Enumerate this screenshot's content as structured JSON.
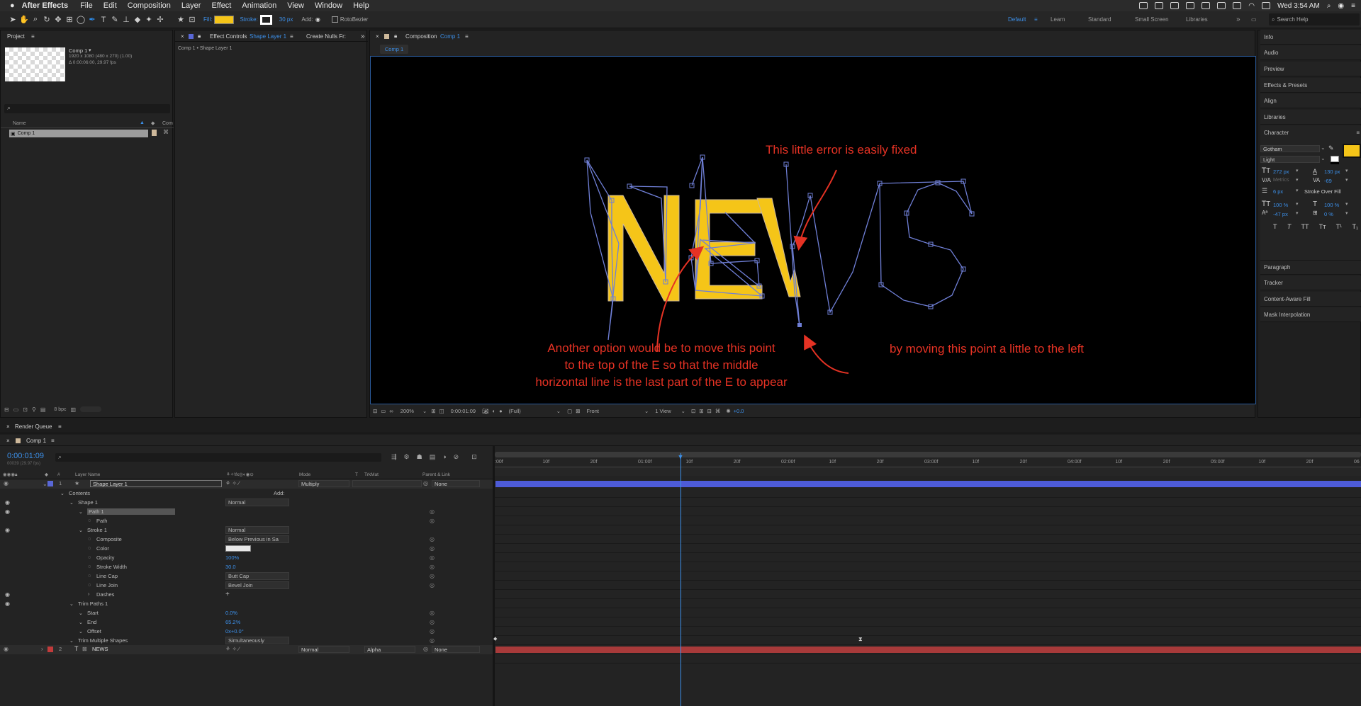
{
  "menubar": {
    "app": "After Effects",
    "items": [
      "File",
      "Edit",
      "Composition",
      "Layer",
      "Effect",
      "Animation",
      "View",
      "Window",
      "Help"
    ],
    "clock": "Wed 3:54 AM"
  },
  "toolbar": {
    "fill_label": "Fill:",
    "stroke_label": "Stroke:",
    "stroke_width": "30 px",
    "add_label": "Add:",
    "rotobezier": "RotoBezier",
    "workspaces": [
      "Default",
      "Learn",
      "Standard",
      "Small Screen",
      "Libraries"
    ],
    "search_placeholder": "Search Help"
  },
  "project": {
    "tab": "Project",
    "comp_name": "Comp 1",
    "comp_info_1": "1920 x 1080  (480 x 270) (1.00)",
    "comp_info_2": "Δ 0:00:06:00, 29.97 fps",
    "col_name": "Name",
    "col_comment": "Com",
    "item": "Comp 1",
    "bpc": "8 bpc"
  },
  "effect_controls": {
    "tab_prefix": "Effect Controls",
    "tab_layer": "Shape Layer 1",
    "tab2": "Create Nulls Fr:",
    "crumb": "Comp 1 • Shape Layer 1"
  },
  "composition": {
    "tab_prefix": "Composition",
    "tab_comp": "Comp 1",
    "subtab": "Comp 1",
    "zoom": "200%",
    "timecode": "0:00:01:09",
    "resolution": "(Full)",
    "view": "Front",
    "views": "1 View",
    "exposure": "+0.0"
  },
  "annotations": {
    "top": "This little error is easily fixed",
    "right": "by moving this point a little to the left",
    "bottom_1": "Another option would be to move this point",
    "bottom_2": "to the top of the E so that the middle",
    "bottom_3": "horizontal line is the last part of the E to appear"
  },
  "artwork": {
    "text_fill": "NEW",
    "text_color": "#f5c518",
    "path_color": "#6f7fd6",
    "annotation_color": "#e53224"
  },
  "right_panels": {
    "items": [
      "Info",
      "Audio",
      "Preview",
      "Effects & Presets",
      "Align",
      "Libraries",
      "Character"
    ],
    "font": "Gotham",
    "style": "Light",
    "font_size": "272 px",
    "leading": "130 px",
    "kerning": "Metrics",
    "tracking": "-69",
    "stroke_width": "6 px",
    "stroke_mode": "Stroke Over Fill",
    "vscale": "100 %",
    "hscale": "100 %",
    "baseline": "-47 px",
    "tsume": "0 %",
    "type_buttons": [
      "T",
      "T",
      "TT",
      "Tт",
      "T¹",
      "T₁"
    ],
    "lower_items": [
      "Paragraph",
      "Tracker",
      "Content-Aware Fill",
      "Mask Interpolation"
    ]
  },
  "render_queue": {
    "tab": "Render Queue"
  },
  "timeline": {
    "tab": "Comp 1",
    "timecode": "0:00:01:09",
    "fps_note": "00039 (29.97 fps)",
    "col_num": "#",
    "col_layer": "Layer Name",
    "col_mode": "Mode",
    "col_t": "T",
    "col_trkmat": "TrkMat",
    "col_parent": "Parent & Link",
    "ruler": [
      ":00f",
      "10f",
      "20f",
      "01:00f",
      "10f",
      "20f",
      "02:00f",
      "10f",
      "20f",
      "03:00f",
      "10f",
      "20f",
      "04:00f",
      "10f",
      "20f",
      "05:00f",
      "10f",
      "20f",
      "06"
    ],
    "layer1": {
      "num": "1",
      "name": "Shape Layer 1",
      "mode": "Multiply",
      "parent": "None"
    },
    "rows": [
      {
        "label": "Contents",
        "indent": 1,
        "value": "Add:"
      },
      {
        "label": "Shape 1",
        "indent": 2,
        "value": "Normal"
      },
      {
        "label": "Path 1",
        "indent": 3,
        "value": ""
      },
      {
        "label": "Path",
        "indent": 4,
        "value": ""
      },
      {
        "label": "Stroke 1",
        "indent": 3,
        "value": "Normal"
      },
      {
        "label": "Composite",
        "indent": 4,
        "value": "Below Previous in Sa"
      },
      {
        "label": "Color",
        "indent": 4,
        "value": ""
      },
      {
        "label": "Opacity",
        "indent": 4,
        "value": "100%"
      },
      {
        "label": "Stroke Width",
        "indent": 4,
        "value": "30.0"
      },
      {
        "label": "Line Cap",
        "indent": 4,
        "value": "Butt Cap"
      },
      {
        "label": "Line Join",
        "indent": 4,
        "value": "Bevel Join"
      },
      {
        "label": "Dashes",
        "indent": 4,
        "value": "+"
      },
      {
        "label": "Trim Paths 1",
        "indent": 2,
        "value": ""
      },
      {
        "label": "Start",
        "indent": 3,
        "value": "0.0%"
      },
      {
        "label": "End",
        "indent": 3,
        "value": "65.2%"
      },
      {
        "label": "Offset",
        "indent": 3,
        "value": "0x+0.0°"
      },
      {
        "label": "Trim Multiple Shapes",
        "indent": 2,
        "value": "Simultaneously"
      }
    ],
    "layer2": {
      "num": "2",
      "name": "NEWS",
      "mode": "Normal",
      "trkmat": "Alpha",
      "parent": "None"
    },
    "playhead_fraction": 0.214,
    "layer1_color": "#4d5bd8",
    "layer2_color": "#a83a3a"
  }
}
